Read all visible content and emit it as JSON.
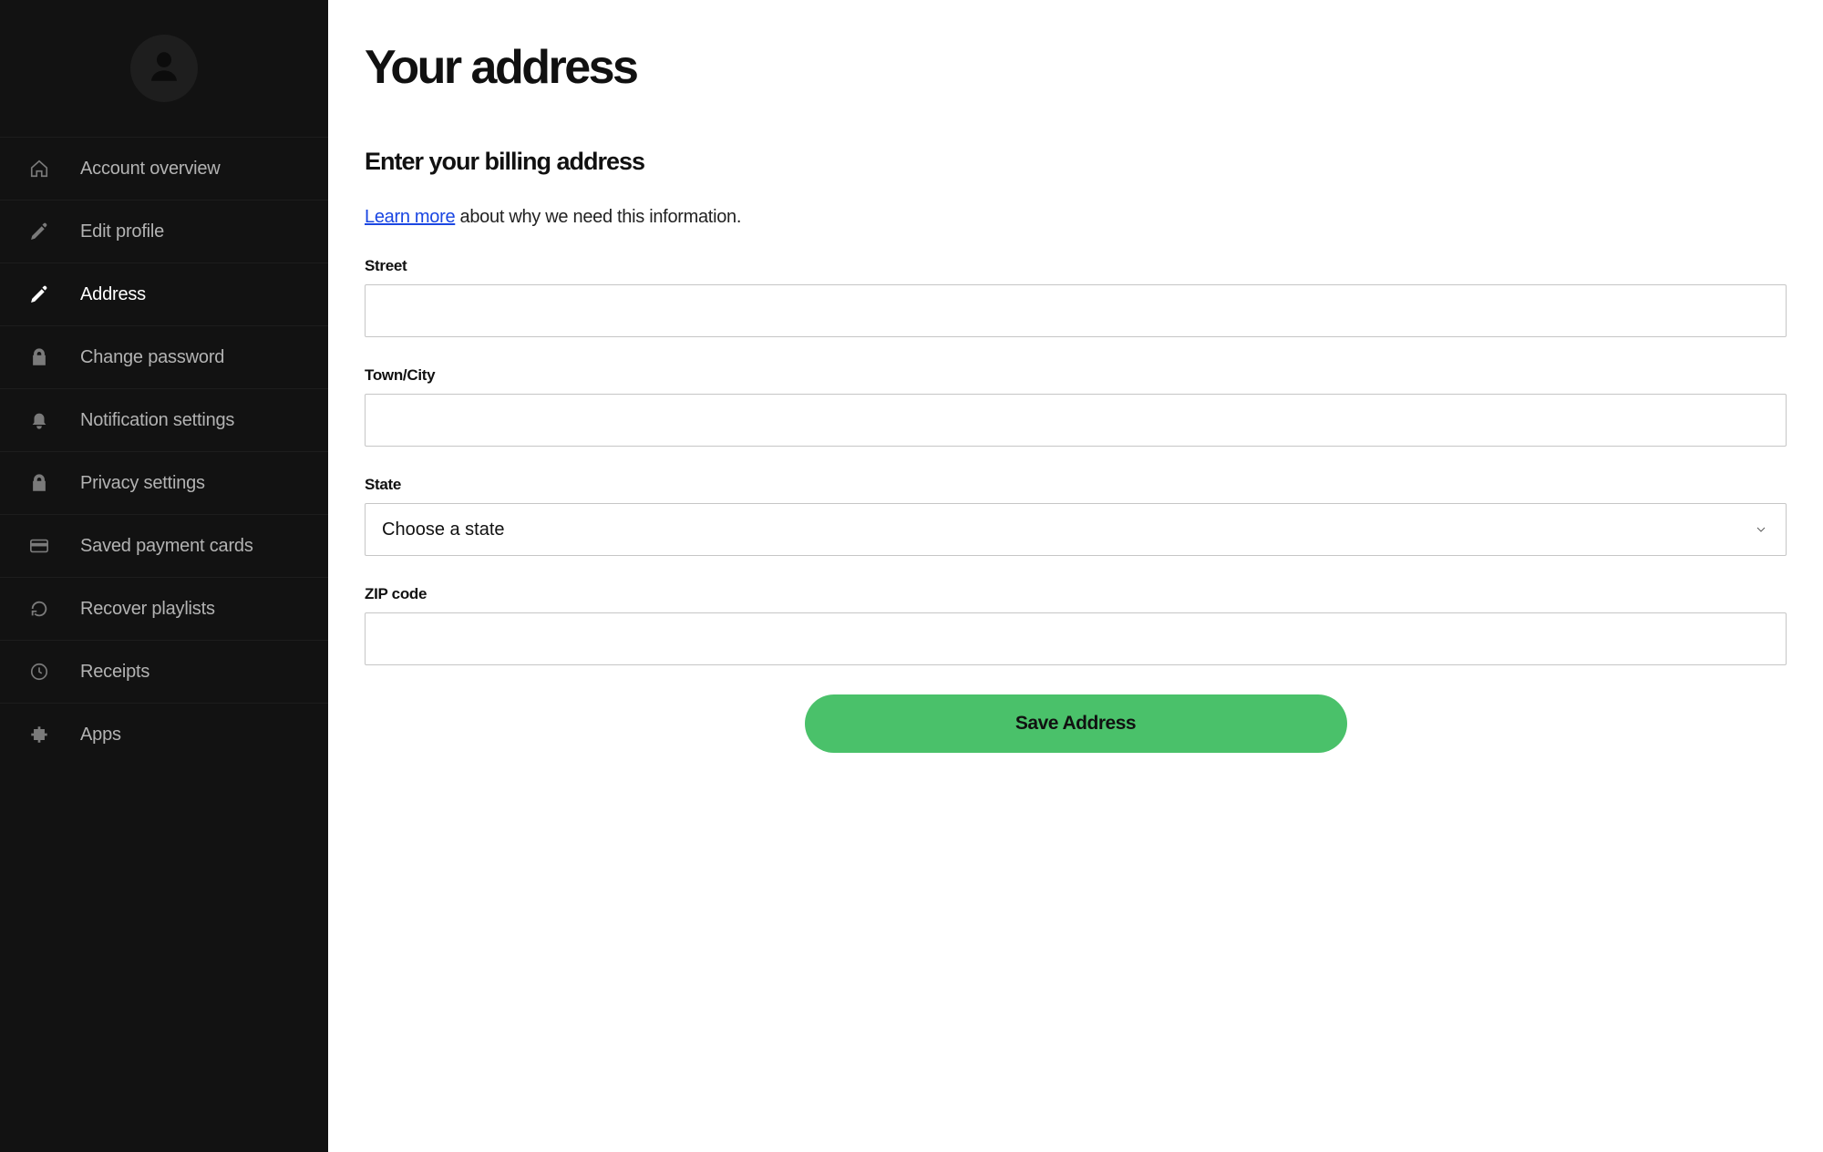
{
  "sidebar": {
    "items": [
      {
        "label": "Account overview",
        "icon": "home-icon",
        "active": false
      },
      {
        "label": "Edit profile",
        "icon": "pencil-icon",
        "active": false
      },
      {
        "label": "Address",
        "icon": "pencil-icon",
        "active": true
      },
      {
        "label": "Change password",
        "icon": "lock-icon",
        "active": false
      },
      {
        "label": "Notification settings",
        "icon": "bell-icon",
        "active": false
      },
      {
        "label": "Privacy settings",
        "icon": "lock-icon",
        "active": false
      },
      {
        "label": "Saved payment cards",
        "icon": "card-icon",
        "active": false
      },
      {
        "label": "Recover playlists",
        "icon": "refresh-icon",
        "active": false
      },
      {
        "label": "Receipts",
        "icon": "clock-icon",
        "active": false
      },
      {
        "label": "Apps",
        "icon": "puzzle-icon",
        "active": false
      }
    ]
  },
  "main": {
    "title": "Your address",
    "section_title": "Enter your billing address",
    "learn_more_label": "Learn more",
    "info_suffix": " about why we need this information.",
    "fields": {
      "street": {
        "label": "Street",
        "value": ""
      },
      "city": {
        "label": "Town/City",
        "value": ""
      },
      "state": {
        "label": "State",
        "selected": "Choose a state"
      },
      "zip": {
        "label": "ZIP code",
        "value": ""
      }
    },
    "save_label": "Save Address"
  },
  "colors": {
    "accent_green": "#4ac16a",
    "link_blue": "#1a46e2",
    "sidebar_bg": "#121212"
  }
}
